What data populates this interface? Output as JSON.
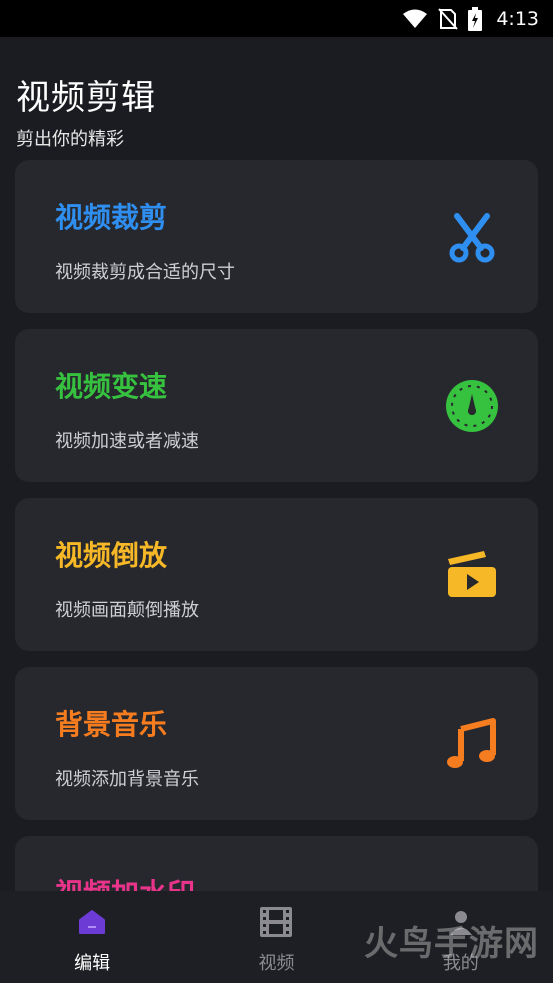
{
  "status_bar": {
    "time": "4:13",
    "icons": [
      "wifi-icon",
      "no-sim-icon",
      "battery-charging-icon"
    ]
  },
  "header": {
    "title": "视频剪辑",
    "subtitle": "剪出你的精彩"
  },
  "cards": [
    {
      "title": "视频裁剪",
      "desc": "视频裁剪成合适的尺寸",
      "color": "#2f8ff0",
      "icon": "scissors-icon"
    },
    {
      "title": "视频变速",
      "desc": "视频加速或者减速",
      "color": "#36c23f",
      "icon": "speedometer-icon"
    },
    {
      "title": "视频倒放",
      "desc": "视频画面颠倒播放",
      "color": "#f6b826",
      "icon": "video-play-icon"
    },
    {
      "title": "背景音乐",
      "desc": "视频添加背景音乐",
      "color": "#f57c1f",
      "icon": "music-note-icon"
    },
    {
      "title": "视频加水印",
      "desc": "",
      "color": "#e8348a",
      "icon": ""
    }
  ],
  "bottom_nav": [
    {
      "label": "编辑",
      "icon": "home-icon",
      "active": true
    },
    {
      "label": "视频",
      "icon": "film-icon",
      "active": false
    },
    {
      "label": "我的",
      "icon": "user-icon",
      "active": false
    }
  ],
  "watermark": {
    "text": "火鸟手游网"
  },
  "colors": {
    "accent_nav": "#6c3bd6",
    "background": "#1b1c21",
    "card": "#27282e"
  }
}
